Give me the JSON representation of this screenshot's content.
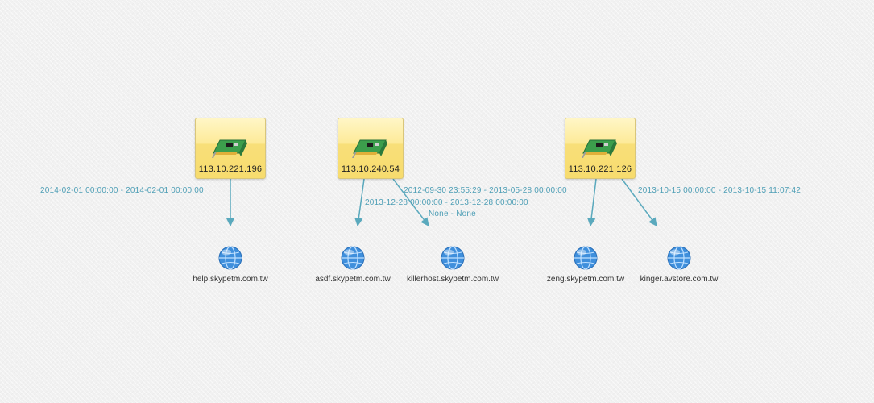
{
  "theme": {
    "edge_color": "#5aa9bd",
    "label_color": "#4f9fb6",
    "node_fill": "#fbe38a"
  },
  "ip_nodes": [
    {
      "id": "ip1",
      "label": "113.10.221.196",
      "icon": "network-card-icon"
    },
    {
      "id": "ip2",
      "label": "113.10.240.54",
      "icon": "network-card-icon"
    },
    {
      "id": "ip3",
      "label": "113.10.221.126",
      "icon": "network-card-icon"
    }
  ],
  "domain_nodes": [
    {
      "id": "d1",
      "label": "help.skypetm.com.tw",
      "icon": "globe-icon"
    },
    {
      "id": "d2",
      "label": "asdf.skypetm.com.tw",
      "icon": "globe-icon"
    },
    {
      "id": "d3",
      "label": "killerhost.skypetm.com.tw",
      "icon": "globe-icon"
    },
    {
      "id": "d4",
      "label": "zeng.skypetm.com.tw",
      "icon": "globe-icon"
    },
    {
      "id": "d5",
      "label": "kinger.avstore.com.tw",
      "icon": "globe-icon"
    }
  ],
  "edges": [
    {
      "from": "ip1",
      "to": "d1",
      "label": "2014-02-01 00:00:00 - 2014-02-01 00:00:00"
    },
    {
      "from": "ip2",
      "to": "d2",
      "label": "2013-12-28 00:00:00 - 2013-12-28 00:00:00"
    },
    {
      "from": "ip2",
      "to": "d3",
      "label": "None - None"
    },
    {
      "from": "ip3",
      "to": "d4",
      "label": "2012-09-30 23:55:29 - 2013-05-28 00:00:00"
    },
    {
      "from": "ip3",
      "to": "d5",
      "label": "2013-10-15 00:00:00 - 2013-10-15 11:07:42"
    }
  ]
}
